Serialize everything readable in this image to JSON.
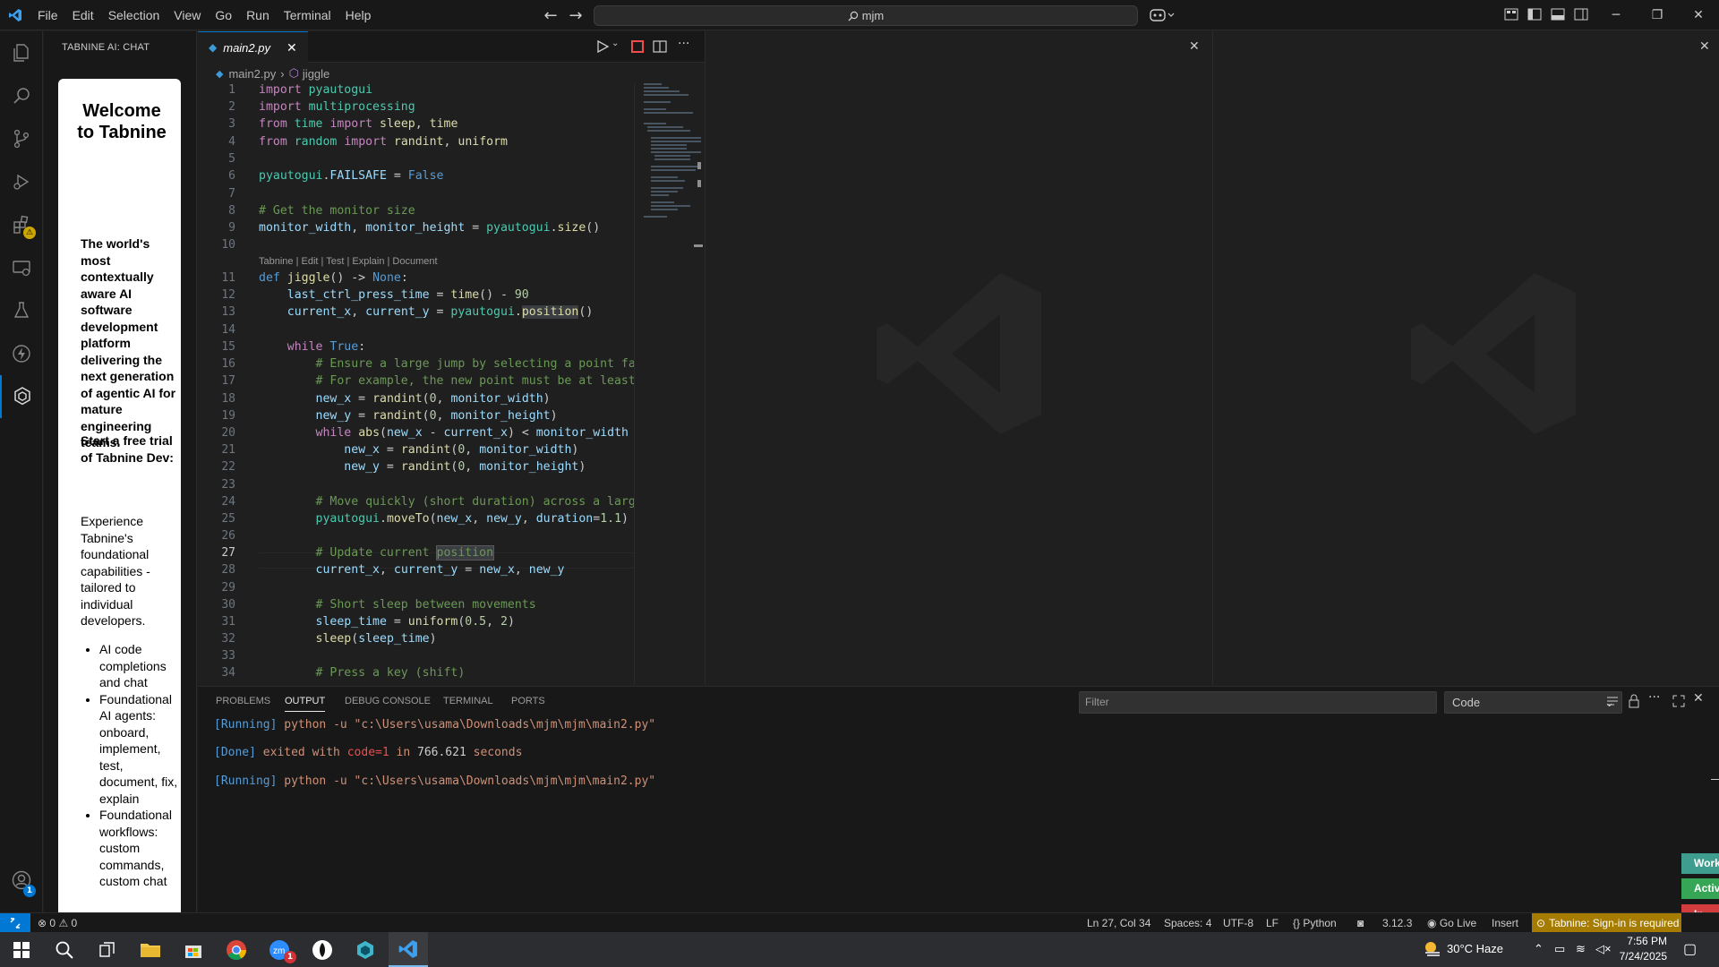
{
  "titlebar": {
    "menu": [
      "File",
      "Edit",
      "Selection",
      "View",
      "Go",
      "Run",
      "Terminal",
      "Help"
    ],
    "search_text": "mjm"
  },
  "sidebar": {
    "title": "TABNINE AI: CHAT",
    "welcome_title": "Welcome to Tabnine",
    "tagline": "The world's most contextually aware AI software development platform delivering the next generation of agentic AI for mature engineering teams.",
    "trial": "Start a free trial of Tabnine Dev:",
    "experience": "Experience Tabnine's foundational capabilities - tailored to individual developers.",
    "bullets": [
      "AI code completions and chat",
      "Foundational AI agents: onboard, implement, test, document, fix, explain",
      "Foundational workflows: custom commands, custom chat"
    ]
  },
  "editor": {
    "tab_label": "main2.py",
    "breadcrumb_file": "main2.py",
    "breadcrumb_symbol": "jiggle",
    "codelens": "Tabnine | Edit | Test | Explain | Document",
    "line_numbers": [
      "1",
      "2",
      "3",
      "4",
      "5",
      "6",
      "7",
      "8",
      "9",
      "10",
      "11",
      "12",
      "13",
      "14",
      "15",
      "16",
      "17",
      "18",
      "19",
      "20",
      "21",
      "22",
      "23",
      "24",
      "25",
      "26",
      "27",
      "28",
      "29",
      "30",
      "31",
      "32",
      "33",
      "34"
    ]
  },
  "panel": {
    "tabs": [
      "PROBLEMS",
      "OUTPUT",
      "DEBUG CONSOLE",
      "TERMINAL",
      "PORTS"
    ],
    "filter_placeholder": "Filter",
    "channel": "Code",
    "out1_tag": "[Running]",
    "out1_text": " python -u \"c:\\Users\\usama\\Downloads\\mjm\\mjm\\main2.py\"",
    "out2_tag": "[Done]",
    "out2_text1": " exited with ",
    "out2_code": "code=1",
    "out2_text2": " in ",
    "out2_secs": "766.621",
    "out2_text3": " seconds",
    "out3_tag": "[Running]",
    "out3_text": " python -u \"c:\\Users\\usama\\Downloads\\mjm\\mjm\\main2.py\""
  },
  "statusbar": {
    "errors": "0",
    "warnings": "0",
    "position": "Ln 27, Col 34",
    "spaces": "Spaces: 4",
    "encoding": "UTF-8",
    "eol": "LF",
    "language": "Python",
    "python_version": "3.12.3",
    "golive": "Go Live",
    "mode": "Insert",
    "tabnine": "Tabnine: Sign-in is required",
    "side_pills": [
      "Work",
      "Activ",
      "In Act"
    ]
  },
  "taskbar": {
    "weather": "30°C  Haze",
    "time": "7:56 PM",
    "date": "7/24/2025"
  },
  "badges": {
    "accounts": "1",
    "manage": "1",
    "zoom": "1"
  },
  "colors": {
    "accent": "#0078d4",
    "tabnine_status": "#a67c00"
  }
}
